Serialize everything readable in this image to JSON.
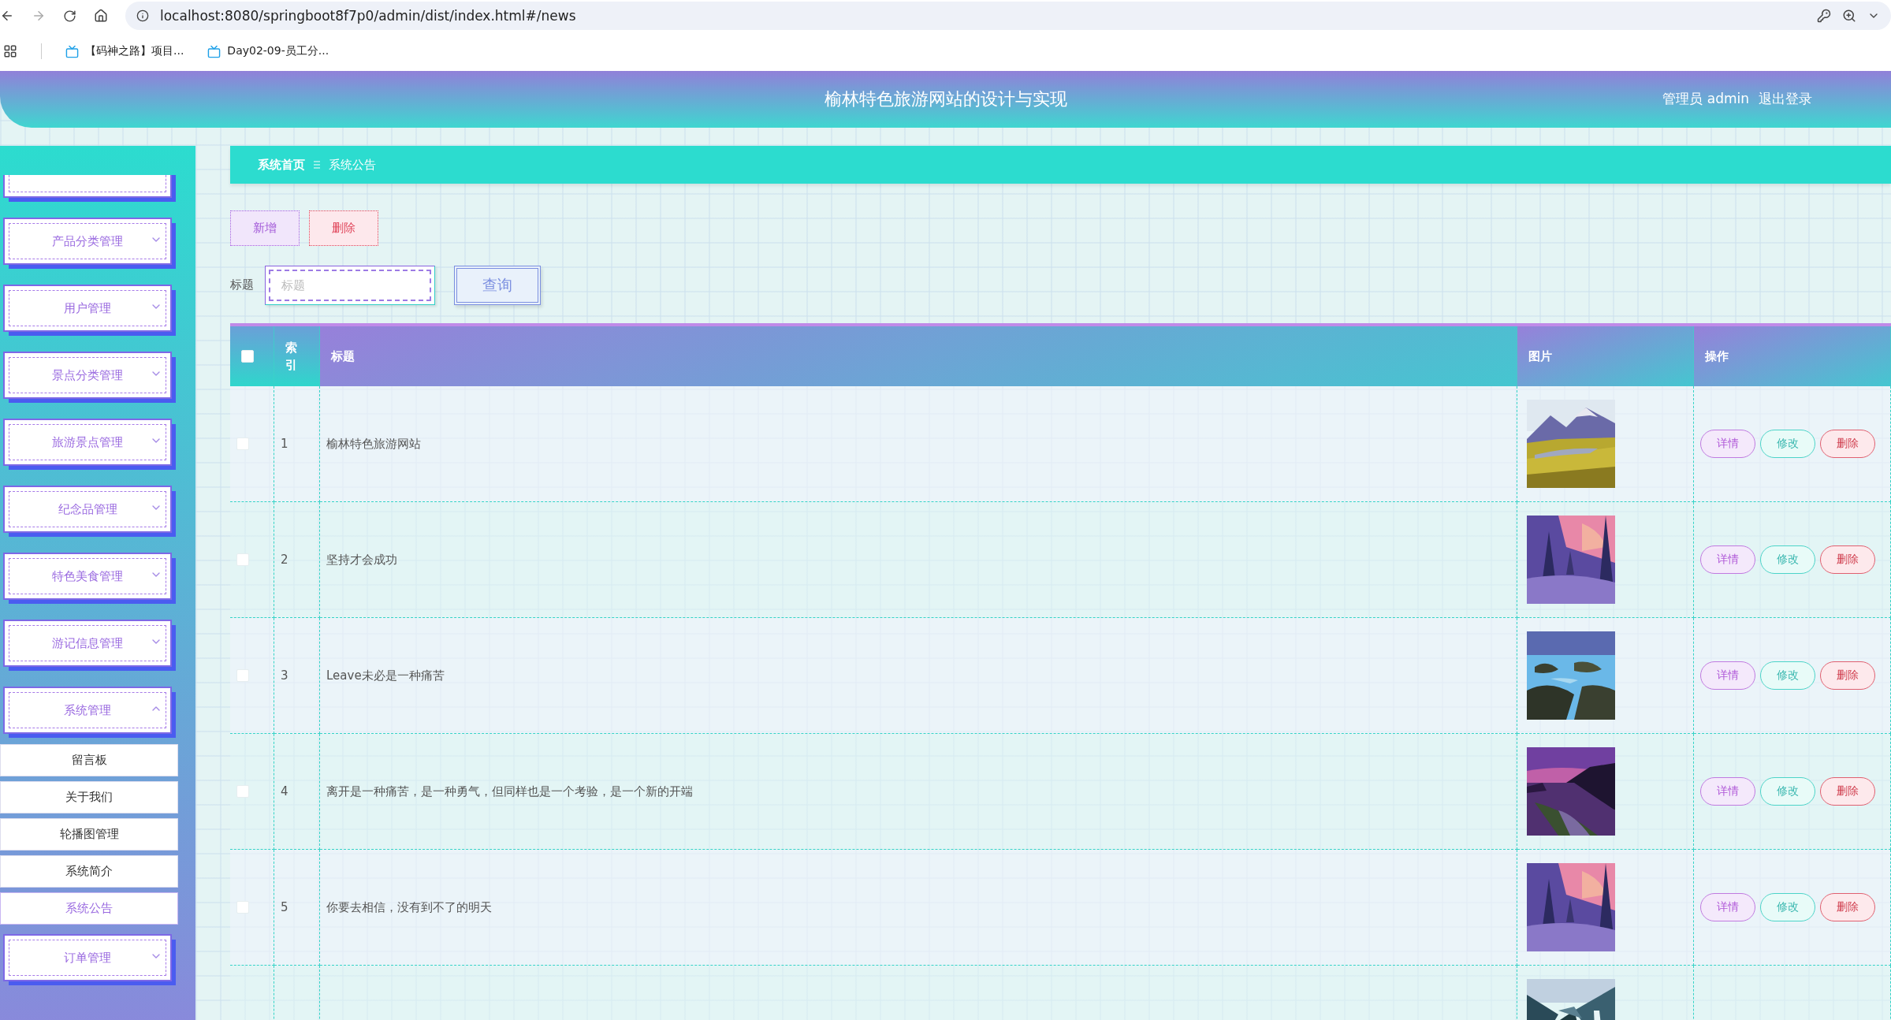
{
  "browser": {
    "url": "localhost:8080/springboot8f7p0/admin/dist/index.html#/news",
    "bookmarks": [
      "【码神之路】项目...",
      "Day02-09-员工分..."
    ]
  },
  "header": {
    "title": "榆林特色旅游网站的设计与实现",
    "user": "管理员 admin",
    "logout": "退出登录"
  },
  "sidebar": {
    "items": [
      {
        "kind": "cut"
      },
      {
        "label": "产品分类管理",
        "expanded": false
      },
      {
        "label": "用户管理",
        "expanded": false
      },
      {
        "label": "景点分类管理",
        "expanded": false
      },
      {
        "label": "旅游景点管理",
        "expanded": false
      },
      {
        "label": "纪念品管理",
        "expanded": false
      },
      {
        "label": "特色美食管理",
        "expanded": false
      },
      {
        "label": "游记信息管理",
        "expanded": false
      },
      {
        "label": "系统管理",
        "expanded": true,
        "children": [
          {
            "label": "留言板",
            "selected": false
          },
          {
            "label": "关于我们",
            "selected": false
          },
          {
            "label": "轮播图管理",
            "selected": false
          },
          {
            "label": "系统简介",
            "selected": false
          },
          {
            "label": "系统公告",
            "selected": true
          }
        ]
      },
      {
        "label": "订单管理",
        "expanded": false
      }
    ]
  },
  "breadcrumb": [
    "系统首页",
    "系统公告"
  ],
  "toolbar": {
    "buttons": [
      {
        "label": "新增",
        "kind": "add"
      },
      {
        "label": "删除",
        "kind": "delete"
      }
    ]
  },
  "search": {
    "label": "标题",
    "placeholder": "标题",
    "button": "查询"
  },
  "table": {
    "select_all_checked": false,
    "columns": [
      "索引",
      "标题",
      "图片",
      "操作"
    ],
    "rows": [
      {
        "checked": false,
        "index": "1",
        "title": "榆林特色旅游网站",
        "image": {
          "kind": "picture"
        },
        "actions": [
          {
            "label": "详情",
            "kind": "detail"
          },
          {
            "label": "修改",
            "kind": "edit"
          },
          {
            "label": "删除",
            "kind": "delete"
          }
        ]
      },
      {
        "checked": false,
        "index": "2",
        "title": "坚持才会成功",
        "image": {
          "kind": "picture"
        },
        "actions": [
          {
            "label": "详情",
            "kind": "detail"
          },
          {
            "label": "修改",
            "kind": "edit"
          },
          {
            "label": "删除",
            "kind": "delete"
          }
        ]
      },
      {
        "checked": false,
        "index": "3",
        "title": "Leave未必是一种痛苦",
        "image": {
          "kind": "picture"
        },
        "actions": [
          {
            "label": "详情",
            "kind": "detail"
          },
          {
            "label": "修改",
            "kind": "edit"
          },
          {
            "label": "删除",
            "kind": "delete"
          }
        ]
      },
      {
        "checked": false,
        "index": "4",
        "title": "离开是一种痛苦，是一种勇气，但同样也是一个考验，是一个新的开端",
        "image": {
          "kind": "picture"
        },
        "actions": [
          {
            "label": "详情",
            "kind": "detail"
          },
          {
            "label": "修改",
            "kind": "edit"
          },
          {
            "label": "删除",
            "kind": "delete"
          }
        ]
      },
      {
        "checked": false,
        "index": "5",
        "title": "你要去相信，没有到不了的明天",
        "image": {
          "kind": "picture"
        },
        "actions": [
          {
            "label": "详情",
            "kind": "detail"
          },
          {
            "label": "修改",
            "kind": "edit"
          },
          {
            "label": "删除",
            "kind": "delete"
          }
        ]
      },
      {
        "image": {
          "kind": "picture"
        }
      }
    ]
  }
}
